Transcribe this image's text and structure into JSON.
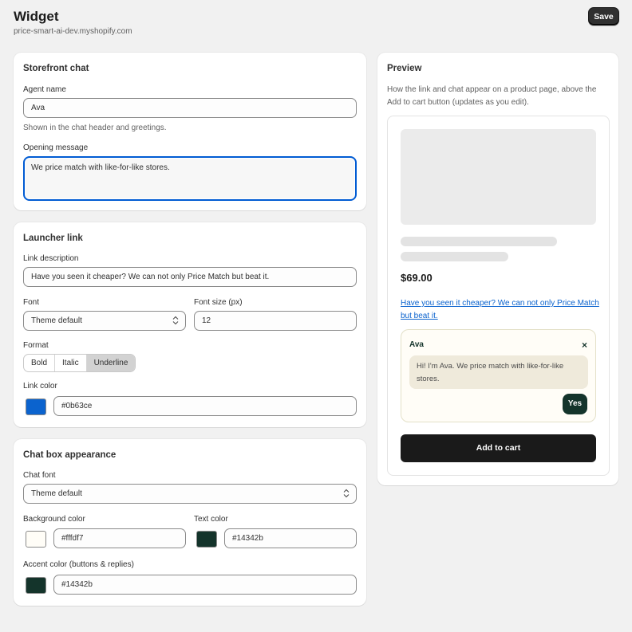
{
  "header": {
    "title": "Widget",
    "subtitle": "price-smart-ai-dev.myshopify.com",
    "save_label": "Save"
  },
  "storefront_chat": {
    "title": "Storefront chat",
    "agent_name_label": "Agent name",
    "agent_name_value": "Ava",
    "agent_name_help": "Shown in the chat header and greetings.",
    "opening_message_label": "Opening message",
    "opening_message_value": "We price match with like-for-like stores."
  },
  "launcher_link": {
    "title": "Launcher link",
    "description_label": "Link description",
    "description_value": "Have you seen it cheaper? We can not only Price Match but beat it.",
    "font_label": "Font",
    "font_value": "Theme default",
    "font_size_label": "Font size (px)",
    "font_size_value": "12",
    "format_label": "Format",
    "format_options": [
      "Bold",
      "Italic",
      "Underline"
    ],
    "format_selected": "Underline",
    "link_color_label": "Link color",
    "link_color_value": "#0b63ce"
  },
  "chat_box": {
    "title": "Chat box appearance",
    "chat_font_label": "Chat font",
    "chat_font_value": "Theme default",
    "bg_color_label": "Background color",
    "bg_color_value": "#fffdf7",
    "text_color_label": "Text color",
    "text_color_value": "#14342b",
    "accent_color_label": "Accent color (buttons & replies)",
    "accent_color_value": "#14342b"
  },
  "preview": {
    "title": "Preview",
    "description": "How the link and chat appear on a product page, above the Add to cart button (updates as you edit).",
    "price": "$69.00",
    "link_text": "Have you seen it cheaper? We can not only Price Match but beat it.",
    "chat_agent": "Ava",
    "chat_close": "×",
    "chat_message": "Hi! I'm Ava. We price match with like-for-like stores.",
    "chat_reply": "Yes",
    "add_to_cart": "Add to cart"
  },
  "colors": {
    "accent": "#14342b",
    "link": "#0b63ce",
    "chat_bg": "#fffdf7",
    "primary_button": "#303030",
    "focus": "#005bd3"
  },
  "icons": {
    "select": "select-arrows-icon",
    "close": "close-icon"
  }
}
